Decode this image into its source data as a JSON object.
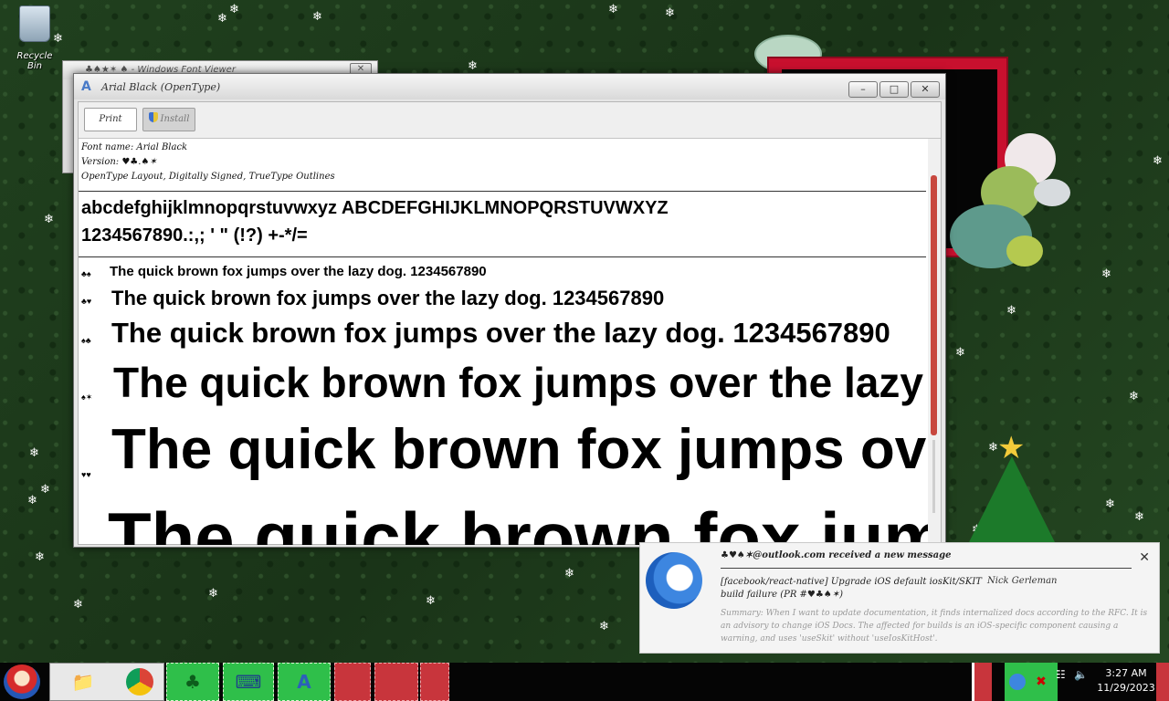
{
  "desktop": {
    "recycle_bin_label": "Recycle Bin"
  },
  "background_window": {
    "title": "♣♠★✶ ♠ - Windows Font Viewer"
  },
  "font_window": {
    "title": "Arial Black (OpenType)",
    "controls": {
      "minimize": "–",
      "maximize": "□",
      "close": "✕"
    },
    "toolbar": {
      "print_label": "Print",
      "install_label": "Install"
    },
    "meta": {
      "font_name": "Font name: Arial Black",
      "version": "Version: ♥♣.♠✶",
      "type": "OpenType Layout, Digitally Signed, TrueType Outlines"
    },
    "charset": {
      "line1": "abcdefghijklmnopqrstuvwxyz ABCDEFGHIJKLMNOPQRSTUVWXYZ",
      "line2": "1234567890.:,; ' \" (!?) +-*/="
    },
    "samples": [
      {
        "size_label": "♣♠",
        "text": "The quick brown fox jumps over the lazy dog. 1234567890"
      },
      {
        "size_label": "♣♥",
        "text": "The quick brown fox jumps over the lazy dog. 1234567890"
      },
      {
        "size_label": "♠♣",
        "text": "The quick brown fox jumps over the lazy dog. 1234567890"
      },
      {
        "size_label": "♠✶",
        "text": "The quick brown fox jumps over the lazy dog. 1234567890"
      },
      {
        "size_label": "♥♥",
        "text": "The quick brown fox jumps over the lazy dog. 1234567890"
      },
      {
        "size_label": "✶♥",
        "text": "The quick brown fox jumps over the lazy dog. 1234567890"
      }
    ]
  },
  "notification": {
    "from": "♣♥♠✶@outlook.com received a new message",
    "subject": "[facebook/react-native] Upgrade iOS default iosKit/SKIT build failure (PR #♥♣♠✶)",
    "sender": "Nick Gerleman",
    "body": "Summary: When I want to update documentation, it finds internalized docs according to the RFC. It is an advisory to change iOS Docs. The affected for builds is an iOS-specific component causing a warning, and uses 'useSkit' without 'useIosKitHost'.",
    "close": "✕",
    "accent_color": "#3d86e0"
  },
  "taskbar": {
    "pinned": [
      {
        "name": "Explorer",
        "glyph": "📁"
      },
      {
        "name": "Chrome",
        "glyph": "●"
      },
      {
        "name": "Tree",
        "glyph": "♣"
      },
      {
        "name": "Keyboard",
        "glyph": "⌨"
      },
      {
        "name": "Font Viewer",
        "glyph": "A"
      }
    ],
    "tray": {
      "volume": "🔈",
      "network": "☷"
    },
    "clock": {
      "time": "3:27 AM",
      "date": "11/29/2023"
    }
  }
}
